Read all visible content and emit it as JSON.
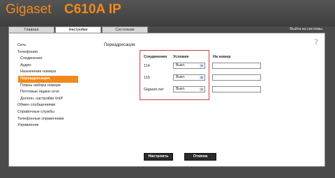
{
  "header": {
    "brand": "Gigaset",
    "model": "C610A IP"
  },
  "tabs": [
    {
      "label": "Главная",
      "active": false
    },
    {
      "label": "Настройки",
      "active": true
    },
    {
      "label": "Состояние",
      "active": false
    }
  ],
  "logout_label": "Выйти из системы",
  "help_icon": "?",
  "nav": {
    "items": [
      {
        "label": "Сеть",
        "level": 0,
        "active": false
      },
      {
        "label": "Телефония",
        "level": 0,
        "active": false
      },
      {
        "label": "Соединения",
        "level": 1,
        "active": false
      },
      {
        "label": "Аудио",
        "level": 1,
        "active": false
      },
      {
        "label": "Назначение номера",
        "level": 1,
        "active": false
      },
      {
        "label": "Переадресация",
        "level": 1,
        "active": true
      },
      {
        "label": "Планы набора номера",
        "level": 1,
        "active": false
      },
      {
        "label": "Почтовые ящики сети",
        "level": 1,
        "active": false
      },
      {
        "label": "Дополн. настройки VoIP",
        "level": 1,
        "active": false
      },
      {
        "label": "Обмен сообщениями",
        "level": 0,
        "active": false
      },
      {
        "label": "Справочные службы",
        "level": 0,
        "active": false
      },
      {
        "label": "Телефонные справочники",
        "level": 0,
        "active": false
      },
      {
        "label": "Управление",
        "level": 0,
        "active": false
      }
    ]
  },
  "forwarding": {
    "section_title": "Переадресация",
    "columns": {
      "connection": "Соединение",
      "condition": "Условие",
      "target": "На номер"
    },
    "rows": [
      {
        "connection": "114",
        "condition": "Выкл.",
        "target": ""
      },
      {
        "connection": "115",
        "condition": "Выкл.",
        "target": ""
      },
      {
        "connection": "Gigaset.net",
        "condition": "Выкл.",
        "target": ""
      }
    ]
  },
  "buttons": {
    "configure": "Настроить",
    "cancel": "Отмена"
  },
  "colors": {
    "accent": "#f08a1c",
    "highlight_border": "#d23a3a",
    "background": "#4a4a4a"
  }
}
